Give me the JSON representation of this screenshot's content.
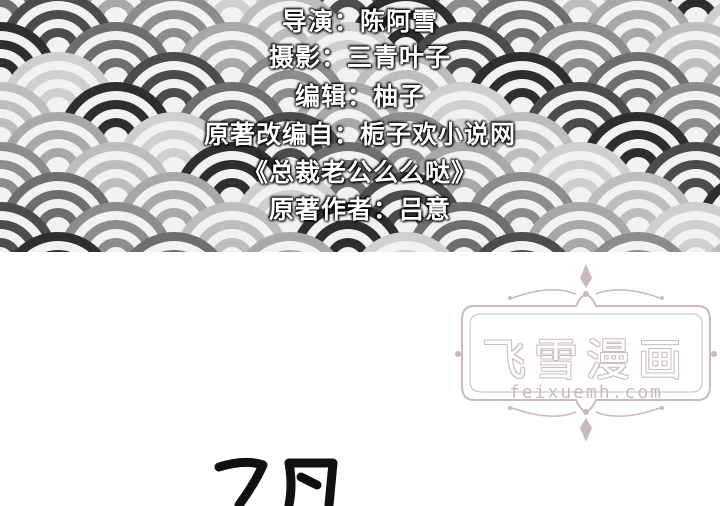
{
  "credits": {
    "director": "导演：陈阿雪",
    "photography": "摄影：三青叶子",
    "editor": "编辑：柚子",
    "source": "原著改编自：栀子欢小说网",
    "novel": "《总裁老公么么哒》",
    "author": "原著作者：吕意"
  },
  "watermark": {
    "title": "飞雪漫画",
    "url": "feixuemh.com"
  },
  "colors": {
    "credit_text": "#ffffff",
    "watermark": "#c9b9ba",
    "wave_dark": "#3a3a3a",
    "wave_light": "#d8d8d8"
  }
}
